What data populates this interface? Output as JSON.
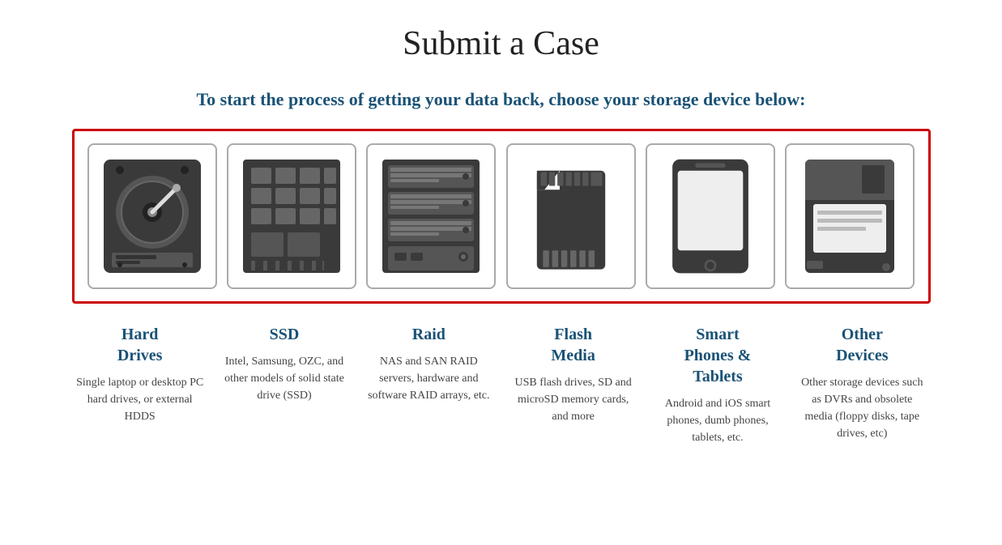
{
  "page": {
    "title": "Submit a Case",
    "subtitle": "To start the process of getting your data back, choose your storage device below:"
  },
  "devices": [
    {
      "id": "hard-drives",
      "label": "Hard\nDrives",
      "description": "Single laptop or desktop PC hard drives, or external HDDS"
    },
    {
      "id": "ssd",
      "label": "SSD",
      "description": "Intel, Samsung, OZC, and other models of solid state drive (SSD)"
    },
    {
      "id": "raid",
      "label": "Raid",
      "description": "NAS and SAN RAID servers, hardware and software RAID arrays, etc."
    },
    {
      "id": "flash-media",
      "label": "Flash\nMedia",
      "description": "USB flash drives, SD and microSD memory cards, and more"
    },
    {
      "id": "smart-phones",
      "label": "Smart\nPhones &\nTablets",
      "description": "Android and iOS smart phones, dumb phones, tablets, etc."
    },
    {
      "id": "other-devices",
      "label": "Other\nDevices",
      "description": "Other storage devices such as DVRs and obsolete media (floppy disks, tape drives, etc)"
    }
  ]
}
